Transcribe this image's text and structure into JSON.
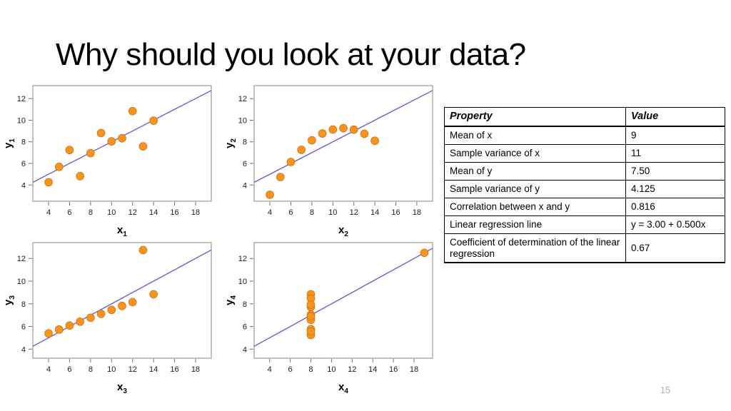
{
  "slide": {
    "title": "Why should you look at your data?",
    "page_number": "15"
  },
  "colors": {
    "dot_fill": "#F8941D",
    "dot_stroke": "#D4761A",
    "regression_line": "#6155D0",
    "panel_border": "#9A9A9A",
    "table_border": "#000000",
    "page_number": "#AEAEAE"
  },
  "table": {
    "headers": [
      "Property",
      "Value"
    ],
    "rows": [
      {
        "property": "Mean of x",
        "value": "9"
      },
      {
        "property": "Sample variance of x",
        "value": "11"
      },
      {
        "property": "Mean of y",
        "value": "7.50"
      },
      {
        "property": "Sample variance of y",
        "value": "4.125"
      },
      {
        "property": "Correlation between x and y",
        "value": "0.816"
      },
      {
        "property": "Linear regression line",
        "value": "y = 3.00 + 0.500x"
      },
      {
        "property": "Coefficient of determination of the linear regression",
        "value": "0.67"
      }
    ]
  },
  "chart_data": [
    {
      "type": "scatter",
      "id": "plot1",
      "title": "",
      "xlabel": "x",
      "xlabel_sub": "1",
      "ylabel": "y",
      "ylabel_sub": "1",
      "xlim": [
        2.5,
        19.5
      ],
      "ylim": [
        2.5,
        13.2
      ],
      "xticks": [
        4,
        6,
        8,
        10,
        12,
        14,
        16,
        18
      ],
      "yticks": [
        4,
        6,
        8,
        10,
        12
      ],
      "grid": false,
      "regression": {
        "intercept": 3.0,
        "slope": 0.5
      },
      "x": [
        10,
        8,
        13,
        9,
        11,
        14,
        6,
        4,
        12,
        7,
        5
      ],
      "y": [
        8.04,
        6.95,
        7.58,
        8.81,
        8.33,
        9.96,
        7.24,
        4.26,
        10.84,
        4.82,
        5.68
      ]
    },
    {
      "type": "scatter",
      "id": "plot2",
      "title": "",
      "xlabel": "x",
      "xlabel_sub": "2",
      "ylabel": "y",
      "ylabel_sub": "2",
      "xlim": [
        2.5,
        19.5
      ],
      "ylim": [
        2.5,
        13.2
      ],
      "xticks": [
        4,
        6,
        8,
        10,
        12,
        14,
        16,
        18
      ],
      "yticks": [
        4,
        6,
        8,
        10,
        12
      ],
      "grid": false,
      "regression": {
        "intercept": 3.0,
        "slope": 0.5
      },
      "x": [
        10,
        8,
        13,
        9,
        11,
        14,
        6,
        4,
        12,
        7,
        5
      ],
      "y": [
        9.14,
        8.14,
        8.74,
        8.77,
        9.26,
        8.1,
        6.13,
        3.1,
        9.13,
        7.26,
        4.74
      ]
    },
    {
      "type": "scatter",
      "id": "plot3",
      "title": "",
      "xlabel": "x",
      "xlabel_sub": "3",
      "ylabel": "y",
      "ylabel_sub": "3",
      "xlim": [
        2.5,
        19.5
      ],
      "ylim": [
        3.2,
        13.4
      ],
      "xticks": [
        4,
        6,
        8,
        10,
        12,
        14,
        16,
        18
      ],
      "yticks": [
        4,
        6,
        8,
        10,
        12
      ],
      "grid": false,
      "regression": {
        "intercept": 3.0,
        "slope": 0.5
      },
      "x": [
        10,
        8,
        13,
        9,
        11,
        14,
        6,
        4,
        12,
        7,
        5
      ],
      "y": [
        7.46,
        6.77,
        12.74,
        7.11,
        7.81,
        8.84,
        6.08,
        5.39,
        8.15,
        6.42,
        5.73
      ]
    },
    {
      "type": "scatter",
      "id": "plot4",
      "title": "",
      "xlabel": "x",
      "xlabel_sub": "4",
      "ylabel": "y",
      "ylabel_sub": "4",
      "xlim": [
        2.5,
        19.8
      ],
      "ylim": [
        3.2,
        13.4
      ],
      "xticks": [
        4,
        6,
        8,
        10,
        12,
        14,
        16,
        18
      ],
      "yticks": [
        4,
        6,
        8,
        10,
        12
      ],
      "grid": false,
      "regression": {
        "intercept": 3.0,
        "slope": 0.5
      },
      "x": [
        8,
        8,
        8,
        8,
        8,
        8,
        8,
        19,
        8,
        8,
        8
      ],
      "y": [
        6.58,
        5.76,
        7.71,
        8.84,
        8.47,
        7.04,
        5.25,
        12.5,
        5.56,
        7.91,
        6.89
      ]
    }
  ]
}
